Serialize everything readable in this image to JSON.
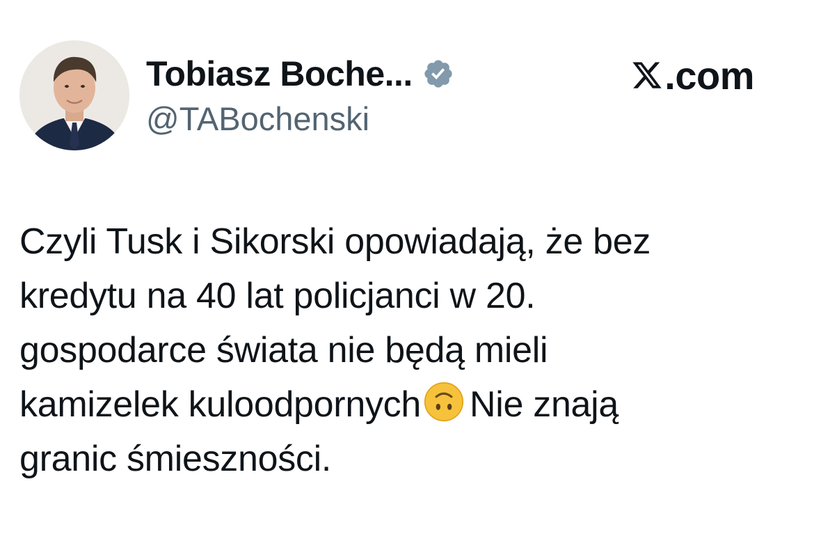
{
  "author": {
    "display_name": "Tobiasz Boche...",
    "handle": "@TABochenski",
    "verified_icon": "verified-badge-icon",
    "avatar": "profile-photo"
  },
  "brand": {
    "logo_icon": "x-logo-icon",
    "text": ".com"
  },
  "tweet": {
    "line1": "Czyli Tusk i Sikorski opowiadają, że bez",
    "line2": "kredytu na 40 lat policjanci w 20.",
    "line3": "gospodarce świata nie będą mieli",
    "line4_before_emoji": "kamizelek kuloodpornych",
    "emoji": "upside-down-face-emoji",
    "line4_after_emoji": "Nie znają",
    "line5": "granic śmieszności."
  },
  "colors": {
    "text_primary": "#0f1419",
    "text_secondary": "#536471",
    "verified_badge": "#829aab",
    "emoji_face": "#f7c23b"
  }
}
